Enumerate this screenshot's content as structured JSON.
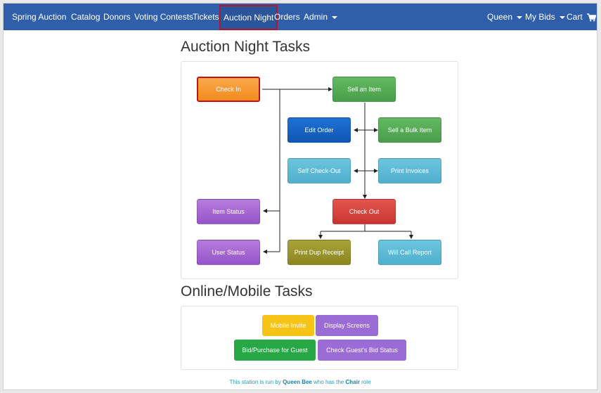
{
  "navbar": {
    "brand": "Spring Auction",
    "links": [
      "Catalog",
      "Donors",
      "Voting Contests",
      "Tickets",
      "Auction Night",
      "Orders"
    ],
    "admin": "Admin",
    "user": "Queen",
    "my_bids": "My Bids",
    "cart": "Cart",
    "active_link": "Auction Night"
  },
  "auction_night": {
    "title": "Auction Night Tasks",
    "nodes": {
      "check_in": "Check In",
      "sell_item": "Sell an Item",
      "edit_order": "Edit Order",
      "sell_bulk": "Sell a Bulk Item",
      "self_checkout": "Self Check-Out",
      "print_invoices": "Print Invoices",
      "item_status": "Item Status",
      "check_out": "Check Out",
      "user_status": "User Status",
      "print_dup_receipt": "Print Dup Receipt",
      "will_call_report": "Will Call Report"
    }
  },
  "online": {
    "title": "Online/Mobile Tasks",
    "buttons": {
      "mobile_invite": "Mobile Invite",
      "display_screens": "Display Screens",
      "bid_purchase": "Bid/Purchase for Guest",
      "check_bid_status": "Check Guest's Bid Status"
    }
  },
  "footer": {
    "prefix": "This station is run by",
    "user_name": "Queen Bee",
    "middle": "who has the",
    "role": "Chair",
    "suffix": "role"
  },
  "colors": {
    "navbar": "#2f5faa",
    "active_outline": "#b5162b"
  }
}
